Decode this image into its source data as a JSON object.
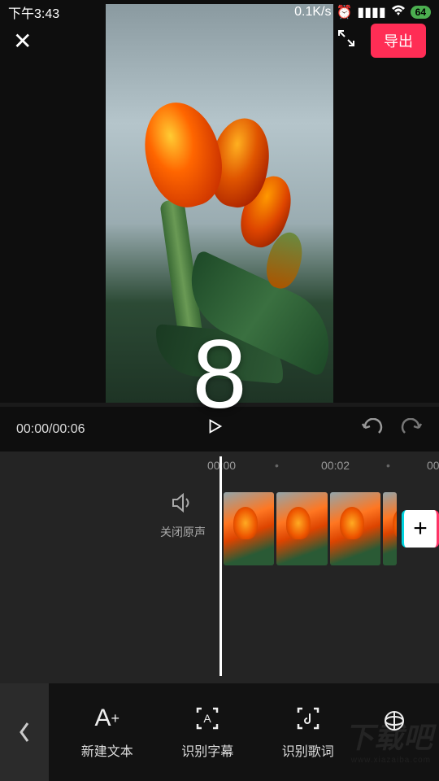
{
  "status": {
    "time": "下午3:43",
    "net_speed": "0.1K/s",
    "battery": "64"
  },
  "top": {
    "export_label": "导出"
  },
  "countdown": "8",
  "playback": {
    "current": "00:00",
    "total": "00:06"
  },
  "timeline": {
    "marks": [
      "00:00",
      "00:02",
      "00"
    ],
    "mute_label": "关闭原声"
  },
  "tools": {
    "new_text": "新建文本",
    "subtitle": "识别字幕",
    "lyrics": "识别歌词"
  },
  "watermark": {
    "main": "下载吧",
    "sub": "www.xiazaiba.com"
  }
}
